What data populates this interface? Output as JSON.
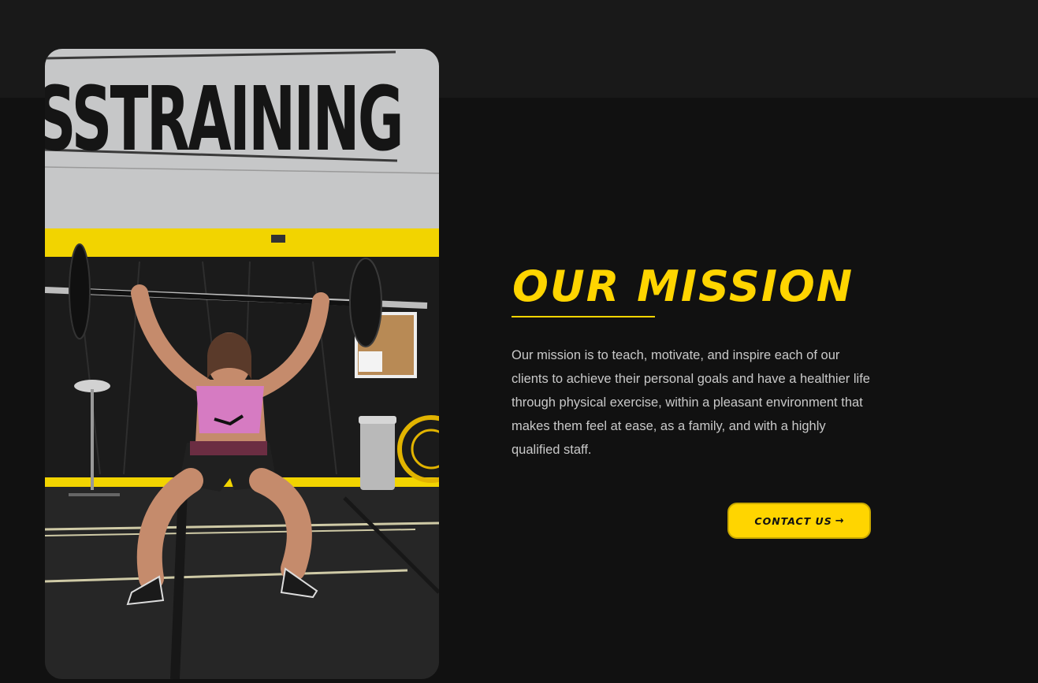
{
  "mission": {
    "title": "OUR MISSION",
    "body": "Our mission is to teach, motivate, and inspire each of our clients to achieve their personal goals and have a healthier life through physical exercise, within a pleasant environment that makes them feel at ease, as a family, and with a highly qualified staff.",
    "button_label": "CONTACT US",
    "button_icon": "arrow-right-icon",
    "button_arrow": "→"
  },
  "photo": {
    "wall_sign": "SSTRAINING"
  },
  "colors": {
    "accent": "#ffd500",
    "background": "#111111",
    "top_band": "#191919",
    "body_text": "#c9c9c9"
  }
}
